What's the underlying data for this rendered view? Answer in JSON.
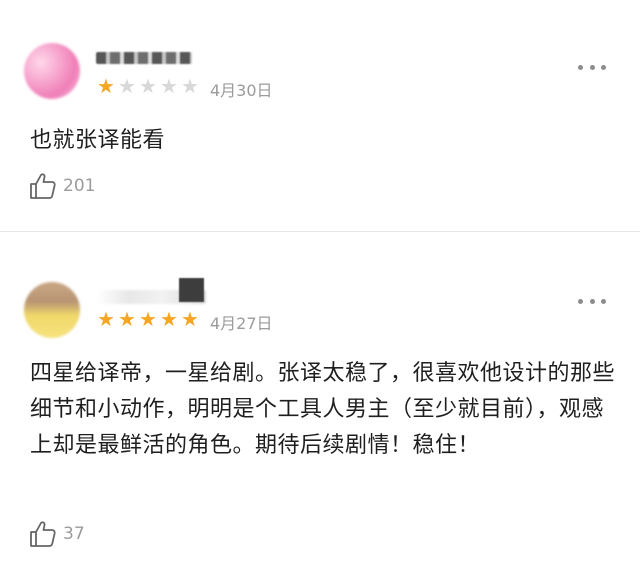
{
  "reviews": [
    {
      "stars": 1,
      "max_stars": 5,
      "date": "4月30日",
      "content": "也就张译能看",
      "likes": "201"
    },
    {
      "stars": 5,
      "max_stars": 5,
      "date": "4月27日",
      "content": "四星给译帝，一星给剧。张译太稳了，很喜欢他设计的那些细节和小动作，明明是个工具人男主（至少就目前），观感上却是最鲜活的角色。期待后续剧情！稳住！",
      "likes": "37"
    }
  ],
  "colors": {
    "star_on": "#f6a623",
    "star_off": "#d8d8d8",
    "meta_text": "#9b9b9b",
    "divider": "#e6e6e6"
  },
  "icons": {
    "like": "thumbs-up-icon",
    "more": "more-dots-icon",
    "star": "star-icon"
  }
}
